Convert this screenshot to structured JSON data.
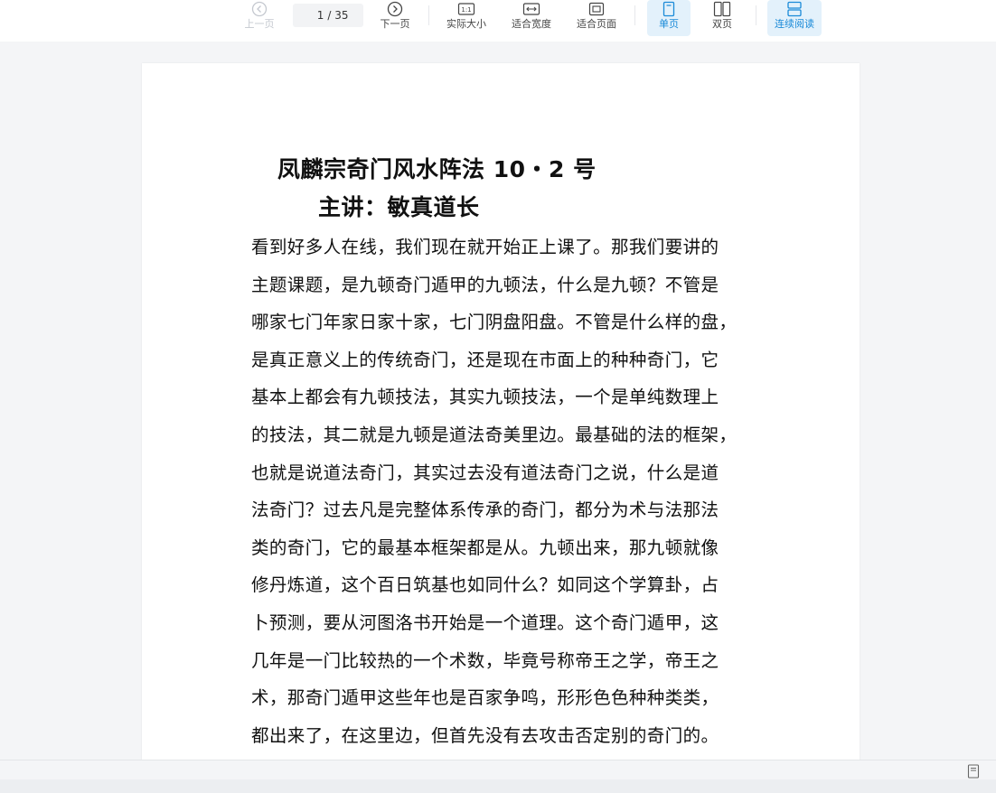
{
  "toolbar": {
    "prev_page": "上一页",
    "page_current": "1",
    "page_total": "/ 35",
    "next_page": "下一页",
    "actual_size": "实际大小",
    "fit_width": "适合宽度",
    "fit_page": "适合页面",
    "single_page": "单页",
    "double_page": "双页",
    "continuous": "连续阅读",
    "accent_color": "#1a8ad8",
    "active_bg": "#e3f1fb"
  },
  "document": {
    "title": "凤麟宗奇门风水阵法 10・2 号",
    "subtitle": "主讲：敏真道长",
    "lines": [
      "看到好多人在线，我们现在就开始正上课了。那我们要讲的",
      "主题课题，是九顿奇门遁甲的九顿法，什么是九顿？不管是",
      "哪家七门年家日家十家，七门阴盘阳盘。不管是什么样的盘，",
      "是真正意义上的传统奇门，还是现在市面上的种种奇门，它",
      "基本上都会有九顿技法，其实九顿技法，一个是单纯数理上",
      "的技法，其二就是九顿是道法奇美里边。最基础的法的框架，",
      "也就是说道法奇门，其实过去没有道法奇门之说，什么是道",
      "法奇门？过去凡是完整体系传承的奇门，都分为术与法那法",
      "类的奇门，它的最基本框架都是从。九顿出来，那九顿就像",
      "修丹炼道，这个百日筑基也如同什么？如同这个学算卦，占",
      "卜预测，要从河图洛书开始是一个道理。这个奇门遁甲，这",
      "几年是一门比较热的一个术数，毕竟号称帝王之学，帝王之",
      "术，那奇门遁甲这些年也是百家争鸣，形形色色种种类类，",
      "都出来了，在这里边，但首先没有去攻击否定别的奇门的。"
    ]
  },
  "status_bar": {
    "icon": "page-view-icon"
  }
}
